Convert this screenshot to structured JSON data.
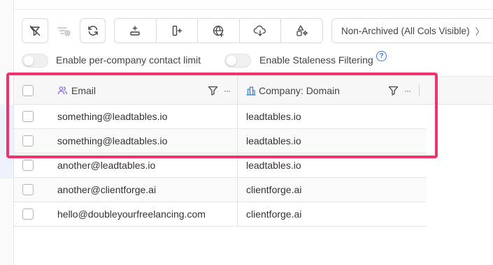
{
  "toolbar": {
    "view_select_value": "Non-Archived (All Cols Visible)"
  },
  "toggles": [
    {
      "label": "Enable per-company contact limit",
      "on": false
    },
    {
      "label": "Enable Staleness Filtering",
      "on": false
    }
  ],
  "help_icon_glyph": "?",
  "table": {
    "columns": [
      {
        "label": "Email",
        "icon": "users-icon"
      },
      {
        "label": "Company: Domain",
        "icon": "building-icon"
      }
    ],
    "menu_glyph": "···",
    "rows": [
      {
        "email": "something@leadtables.io",
        "domain": "leadtables.io"
      },
      {
        "email": "something@leadtables.io",
        "domain": "leadtables.io"
      },
      {
        "email": "another@leadtables.io",
        "domain": "leadtables.io"
      },
      {
        "email": "another@clientforge.ai",
        "domain": "clientforge.ai"
      },
      {
        "email": "hello@doubleyourfreelancing.com",
        "domain": "clientforge.ai"
      }
    ]
  },
  "colors": {
    "highlight": "#f2336b",
    "help_blue": "#2f7de1",
    "email_icon": "#8b5cf6",
    "domain_icon": "#2f7de1"
  }
}
